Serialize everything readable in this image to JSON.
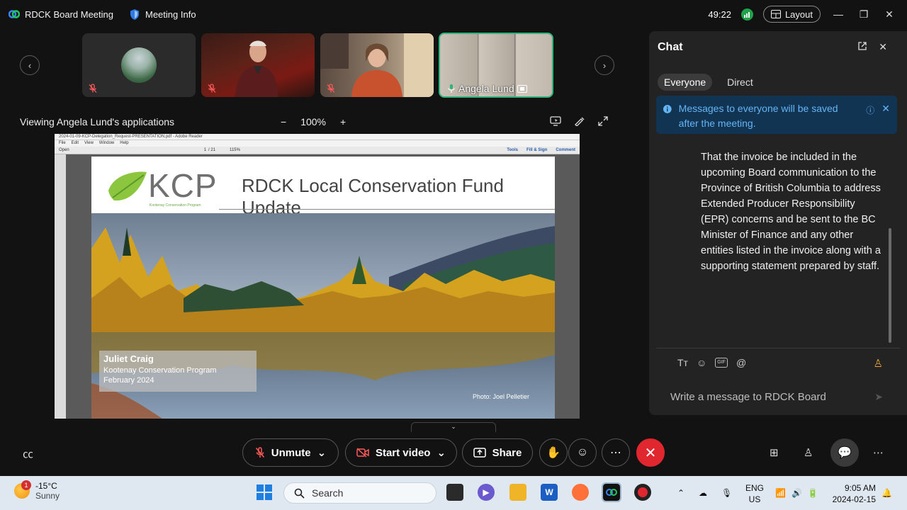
{
  "titlebar": {
    "app_name": "RDCK Board Meeting",
    "meeting_info": "Meeting Info",
    "timer": "49:22",
    "layout_label": "Layout"
  },
  "participants": [
    {
      "name": "",
      "muted": true
    },
    {
      "name": "",
      "muted": true
    },
    {
      "name": "",
      "muted": true
    },
    {
      "name": "Angela Lund",
      "muted": false,
      "active_speaker": true
    }
  ],
  "share": {
    "title": "Viewing Angela Lund's applications",
    "zoom_level": "100%",
    "zoom_out": "−",
    "zoom_in": "+"
  },
  "document": {
    "window_title": "2024-01-09-KCP-Delegation_Request-PRESENTATION.pdf - Adobe Reader",
    "menu": [
      "File",
      "Edit",
      "View",
      "Window",
      "Help"
    ],
    "toolbar_open": "Open",
    "page_current": "1",
    "page_total": "/ 21",
    "doc_zoom": "115%",
    "toolbar_right": [
      "Tools",
      "Fill & Sign",
      "Comment"
    ],
    "slide": {
      "logo_text": "KCP",
      "logo_subtitle": "Kootenay Conservation Program",
      "title": "RDCK Local Conservation Fund Update",
      "presenter_name": "Juliet Craig",
      "presenter_org": "Kootenay Conservation Program",
      "presenter_date": "February 2024",
      "photo_credit": "Photo: Joel  Pelletier"
    }
  },
  "chat": {
    "title": "Chat",
    "tabs": [
      {
        "label": "Everyone",
        "active": true
      },
      {
        "label": "Direct",
        "active": false
      }
    ],
    "notice": "Messages to everyone will be saved after the meeting.",
    "message": "That the invoice be included in the upcoming Board communication to the Province of British Columbia  to address Extended Producer Responsibility (EPR) concerns and be sent to the BC Minister of Finance and any other entities listed in the invoice along with a supporting statement prepared by staff.",
    "input_placeholder": "Write a message to RDCK Board",
    "gif_label": "GIF"
  },
  "controls": {
    "unmute": "Unmute",
    "start_video": "Start video",
    "share": "Share"
  },
  "taskbar": {
    "temperature": "-15°C",
    "weather": "Sunny",
    "notification_count": "1",
    "search_placeholder": "Search",
    "lang_1": "ENG",
    "lang_2": "US",
    "time": "9:05 AM",
    "date": "2024-02-15"
  },
  "colors": {
    "accent_green": "#2fb37d",
    "end_call_red": "#e0262f",
    "notice_blue": "#64b5f6",
    "notice_bg": "#123453"
  }
}
